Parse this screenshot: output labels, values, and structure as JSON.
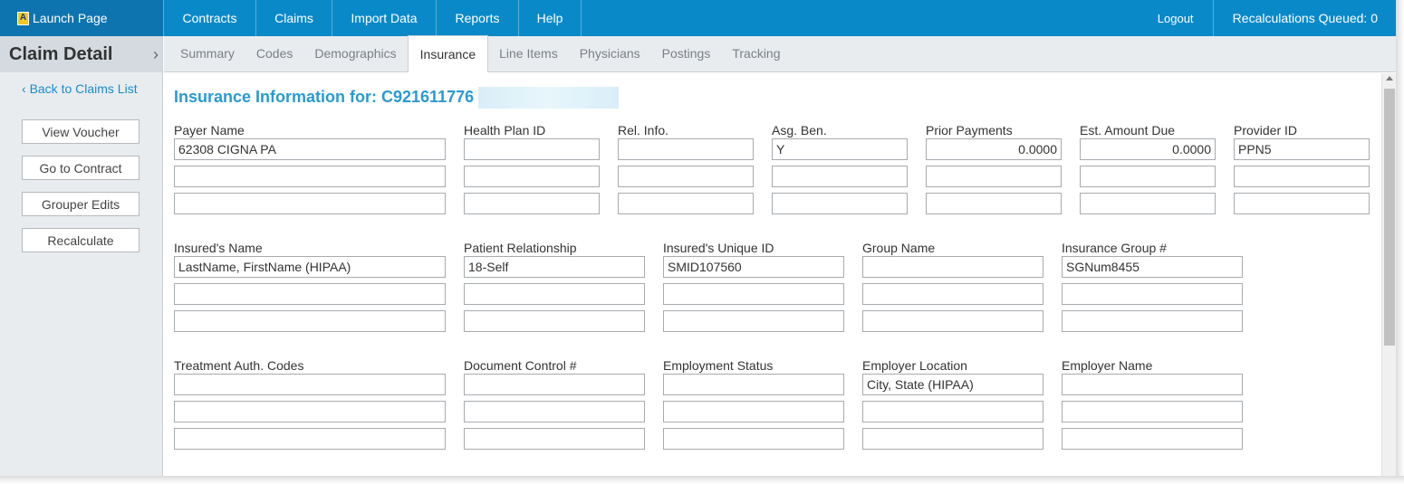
{
  "topnav": {
    "launch_label": "Launch Page",
    "launch_icon_glyph": "A",
    "items": [
      {
        "label": "Contracts"
      },
      {
        "label": "Claims"
      },
      {
        "label": "Import Data"
      },
      {
        "label": "Reports"
      },
      {
        "label": "Help"
      }
    ],
    "logout_label": "Logout",
    "queued_label": "Recalculations Queued: 0"
  },
  "sidebar": {
    "title": "Claim Detail",
    "collapse_glyph": "›",
    "back_label": "Back to Claims List",
    "back_glyph": "‹",
    "buttons": [
      {
        "label": "View Voucher"
      },
      {
        "label": "Go to Contract"
      },
      {
        "label": "Grouper Edits"
      },
      {
        "label": "Recalculate"
      }
    ]
  },
  "tabs": [
    {
      "label": "Summary"
    },
    {
      "label": "Codes"
    },
    {
      "label": "Demographics"
    },
    {
      "label": "Insurance",
      "active": true
    },
    {
      "label": "Line Items"
    },
    {
      "label": "Physicians"
    },
    {
      "label": "Postings"
    },
    {
      "label": "Tracking"
    }
  ],
  "main": {
    "title": "Insurance Information for: C921611776 --",
    "groups": [
      {
        "fields": [
          {
            "label": "Payer Name",
            "values": [
              "62308 CIGNA PA",
              "",
              ""
            ]
          },
          {
            "label": "Health Plan ID",
            "values": [
              "",
              "",
              ""
            ]
          },
          {
            "label": "Rel. Info.",
            "values": [
              "",
              "",
              ""
            ]
          },
          {
            "label": "Asg. Ben.",
            "values": [
              "Y",
              "",
              ""
            ]
          },
          {
            "label": "Prior Payments",
            "values": [
              "0.0000",
              "",
              ""
            ],
            "numeric": true
          },
          {
            "label": "Est. Amount Due",
            "values": [
              "0.0000",
              "",
              ""
            ],
            "numeric": true
          },
          {
            "label": "Provider ID",
            "values": [
              "PPN5",
              "",
              ""
            ]
          }
        ]
      },
      {
        "fields": [
          {
            "label": "Insured's Name",
            "values": [
              "LastName, FirstName (HIPAA)",
              "",
              ""
            ]
          },
          {
            "label": "Patient Relationship",
            "values": [
              "18-Self",
              "",
              ""
            ]
          },
          {
            "label": "Insured's Unique ID",
            "values": [
              "SMID107560",
              "",
              ""
            ]
          },
          {
            "label": "Group Name",
            "values": [
              "",
              "",
              ""
            ]
          },
          {
            "label": "Insurance Group #",
            "values": [
              "SGNum8455",
              "",
              ""
            ]
          }
        ]
      },
      {
        "fields": [
          {
            "label": "Treatment Auth. Codes",
            "values": [
              "",
              "",
              ""
            ]
          },
          {
            "label": "Document Control #",
            "values": [
              "",
              "",
              ""
            ]
          },
          {
            "label": "Employment Status",
            "values": [
              "",
              "",
              ""
            ]
          },
          {
            "label": "Employer Location",
            "values": [
              "City, State (HIPAA)",
              "",
              ""
            ]
          },
          {
            "label": "Employer Name",
            "values": [
              "",
              "",
              ""
            ]
          }
        ]
      }
    ]
  }
}
